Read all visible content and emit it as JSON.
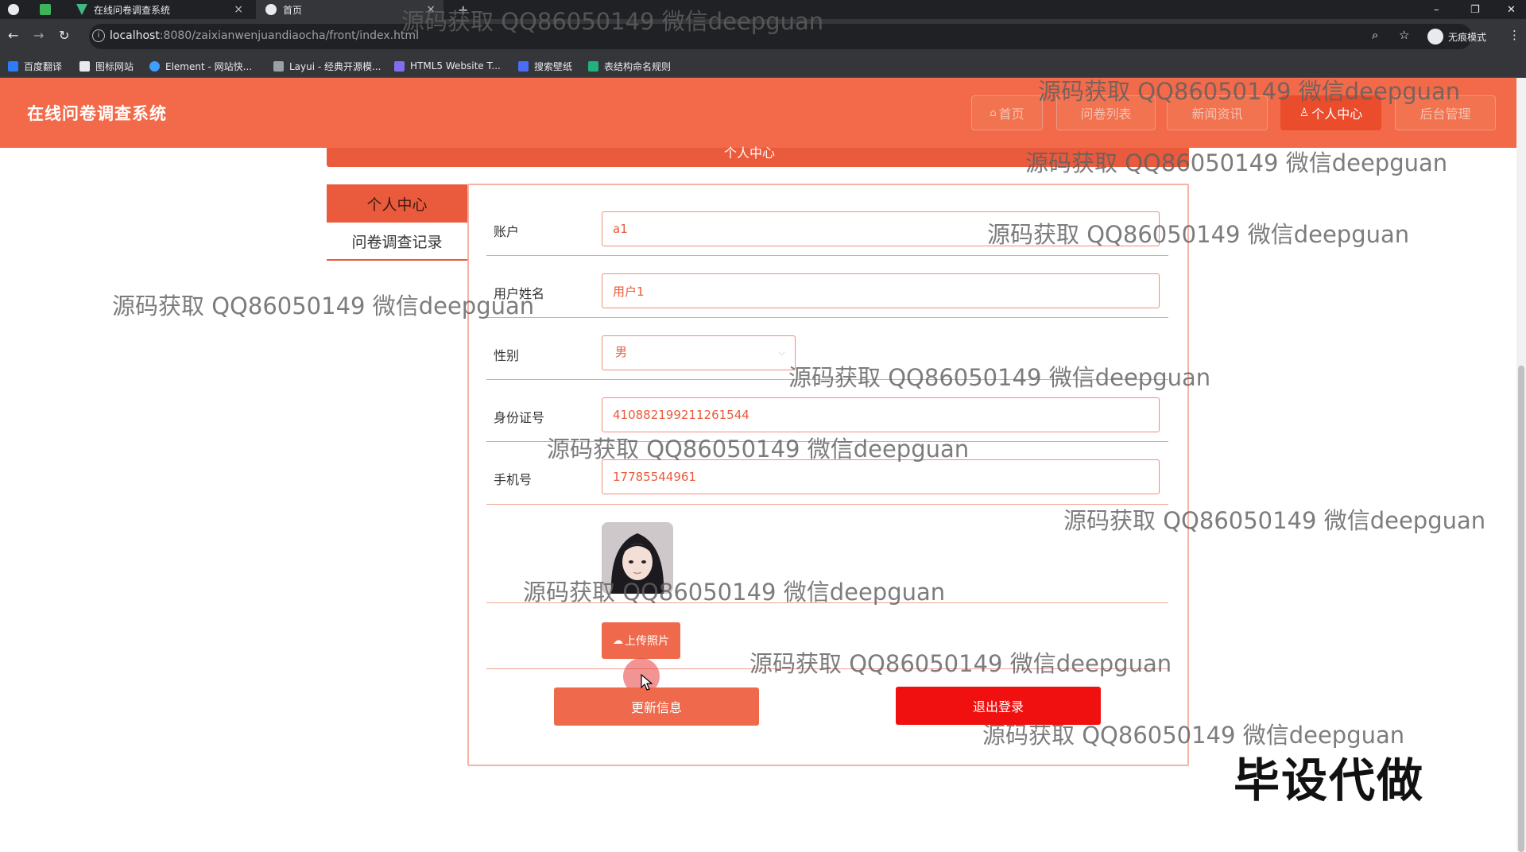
{
  "browser": {
    "tabs": [
      {
        "label": "在线问卷调查系统",
        "active": false
      },
      {
        "label": "首页",
        "active": true
      }
    ],
    "new_tab": "+",
    "url_host": "localhost",
    "url_rest": ":8080/zaixianwenjuandiaocha/front/index.html",
    "incognito_label": "无痕模式",
    "bookmarks": [
      "百度翻译",
      "图标网站",
      "Element - 网站快...",
      "Layui - 经典开源模...",
      "HTML5 Website T...",
      "搜索壁纸",
      "表结构命名规则"
    ]
  },
  "header": {
    "site_title": "在线问卷调查系统",
    "nav": [
      {
        "label": "首页",
        "active": false
      },
      {
        "label": "问卷列表",
        "active": false
      },
      {
        "label": "新闻资讯",
        "active": false
      },
      {
        "label": "个人中心",
        "active": true
      },
      {
        "label": "后台管理",
        "active": false
      }
    ]
  },
  "page": {
    "strip_title": "个人中心"
  },
  "sidebar": {
    "items": [
      {
        "label": "个人中心",
        "active": true
      },
      {
        "label": "问卷调查记录",
        "active": false
      }
    ]
  },
  "form": {
    "account_label": "账户",
    "account_value": "a1",
    "name_label": "用户姓名",
    "name_value": "用户1",
    "gender_label": "性别",
    "gender_value": "男",
    "id_label": "身份证号",
    "id_value": "410882199211261544",
    "phone_label": "手机号",
    "phone_value": "17785544961",
    "upload_label": "上传照片",
    "update_label": "更新信息",
    "logout_label": "退出登录"
  },
  "overlay": {
    "watermark": "源码获取 QQ86050149 微信deepguan",
    "big_text": "毕设代做"
  },
  "colors": {
    "brand": "#f26a4a",
    "accent": "#ea5a3c",
    "danger": "#f01010"
  },
  "icons": [
    "back-arrow-icon",
    "forward-arrow-icon",
    "reload-icon",
    "info-icon",
    "zoom-icon",
    "star-icon",
    "menu-dots-icon",
    "home-icon",
    "user-icon",
    "cloud-upload-icon",
    "chevron-down-icon",
    "cursor-icon"
  ]
}
